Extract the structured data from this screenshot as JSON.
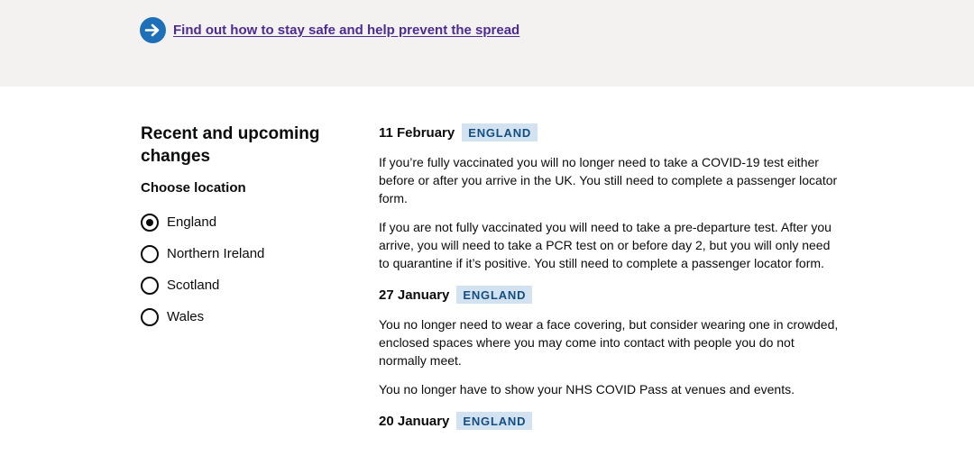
{
  "banner": {
    "link_text": "Find out how to stay safe and help prevent the spread",
    "icon": "arrow-right-icon"
  },
  "sidebar": {
    "title": "Recent and upcoming changes",
    "choose_label": "Choose location",
    "options": [
      {
        "label": "England",
        "checked": true
      },
      {
        "label": "Northern Ireland",
        "checked": false
      },
      {
        "label": "Scotland",
        "checked": false
      },
      {
        "label": "Wales",
        "checked": false
      }
    ]
  },
  "entries": [
    {
      "date": "11 February",
      "tag": "ENGLAND",
      "paragraphs": [
        "If you’re fully vaccinated you will no longer need to take a COVID-19 test either before or after you arrive in the UK. You still need to complete a passenger locator form.",
        "If you are not fully vaccinated you will need to take a pre-departure test. After you arrive, you will need to take a PCR test on or before day 2, but you will only need to quarantine if it’s positive. You still need to complete a passenger locator form."
      ]
    },
    {
      "date": "27 January",
      "tag": "ENGLAND",
      "paragraphs": [
        "You no longer need to wear a face covering, but consider wearing one in crowded, enclosed spaces where you may come into contact with people you do not normally meet.",
        "You no longer have to show your NHS COVID Pass at venues and events."
      ]
    },
    {
      "date": "20 January",
      "tag": "ENGLAND",
      "paragraphs": []
    }
  ],
  "colors": {
    "link": "#4c2c92",
    "icon_blue": "#1d70b8",
    "tag_bg": "#d2e2f1",
    "tag_text": "#144e81",
    "band": "#f3f2f1"
  }
}
